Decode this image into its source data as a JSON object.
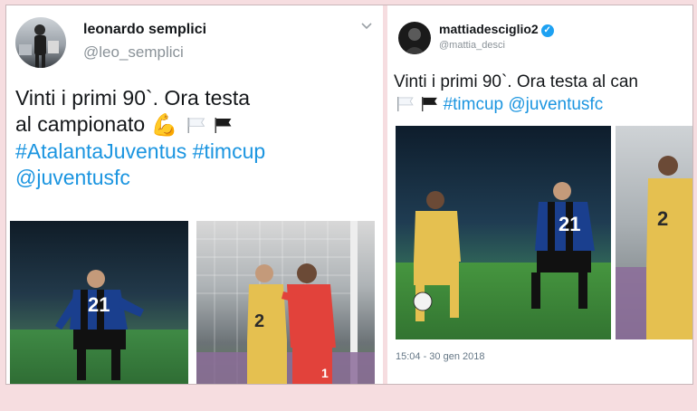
{
  "left_tweet": {
    "display_name": "leonardo semplici",
    "handle": "@leo_semplici",
    "text_line1": "Vinti i primi 90`. Ora testa",
    "text_line2": "al campionato",
    "hashtag1": "#AtalantaJuventus",
    "hashtag2": "#timcup",
    "mention": "@juventusfc",
    "muscle_emoji": "💪",
    "photo1_jersey": "21",
    "photo2_jersey": "2",
    "photo2_keeper_jersey": "1"
  },
  "right_tweet": {
    "display_name": "mattiadesciglio2",
    "handle": "@mattia_desci",
    "verified_icon": "✓",
    "text_line1": "Vinti i primi 90`. Ora testa al can",
    "hashtag": "#timcup",
    "mention": "@juventusfc",
    "photo_jersey_main": "21",
    "photo_jersey_side": "2",
    "timestamp": "15:04 - 30 gen 2018"
  },
  "colors": {
    "link": "#1b95e0",
    "background": "#f6dde0",
    "atalanta_blue": "#1a3f8e",
    "juve_yellow": "#e5c050"
  },
  "icons": [
    "chevron-down-icon",
    "verified-icon",
    "white-flag-icon",
    "black-flag-icon",
    "flexed-biceps-icon"
  ]
}
